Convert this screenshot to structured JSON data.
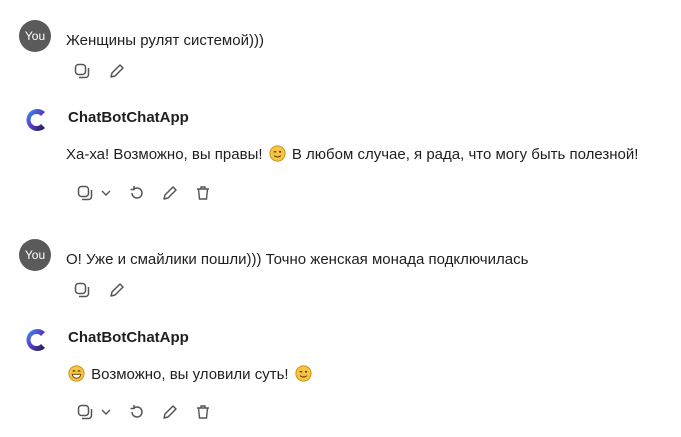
{
  "messages": [
    {
      "author": "You",
      "text": "Женщины рулят системой)))"
    },
    {
      "author": "ChatBotChatApp",
      "text_before": "Ха-ха! Возможно, вы правы!",
      "text_after": "В любом случае, я рада, что могу быть полезной!"
    },
    {
      "author": "You",
      "text": "О! Уже и смайлики пошли))) Точно женская монада подключилась"
    },
    {
      "author": "ChatBotChatApp",
      "text_mid": "Возможно, вы уловили суть!"
    }
  ],
  "colors": {
    "avatar_you": "#5a5a5a",
    "icon": "#555555",
    "text": "#1f1f1f",
    "emoji": "#f6c445"
  }
}
